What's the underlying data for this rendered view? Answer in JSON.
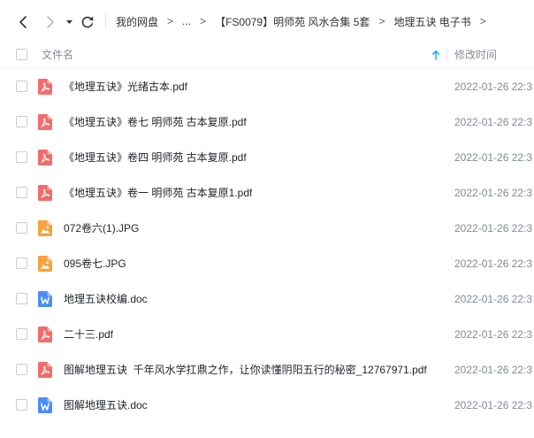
{
  "navigation": {
    "back_icon": "back-icon",
    "forward_icon": "forward-icon",
    "dropdown_icon": "history-dropdown-icon",
    "refresh_icon": "refresh-icon"
  },
  "breadcrumb": {
    "items": [
      "我的网盘",
      "...",
      "【FS0079】明师苑 风水合集 5套",
      "地理五诀 电子书"
    ],
    "separator": ">"
  },
  "table": {
    "columns": {
      "name": "文件名",
      "modified": "修改时间"
    },
    "sort": {
      "column": "name",
      "direction": "ascending",
      "icon": "sort-ascending-icon"
    },
    "rows": [
      {
        "name": "《地理五诀》光绪古本.pdf",
        "icon": "pdf-file-icon",
        "modified": "2022-01-26 22:3"
      },
      {
        "name": "《地理五诀》卷七 明师苑 古本复原.pdf",
        "icon": "pdf-file-icon",
        "modified": "2022-01-26 22:3"
      },
      {
        "name": "《地理五诀》卷四 明师苑 古本复原.pdf",
        "icon": "pdf-file-icon",
        "modified": "2022-01-26 22:3"
      },
      {
        "name": "《地理五诀》卷一 明师苑 古本复原1.pdf",
        "icon": "pdf-file-icon",
        "modified": "2022-01-26 22:3"
      },
      {
        "name": "072卷六(1).JPG",
        "icon": "image-file-icon",
        "modified": "2022-01-26 22:3"
      },
      {
        "name": "095卷七.JPG",
        "icon": "image-file-icon",
        "modified": "2022-01-26 22:3"
      },
      {
        "name": "地理五诀校编.doc",
        "icon": "word-file-icon",
        "modified": "2022-01-26 22:3"
      },
      {
        "name": "二十三.pdf",
        "icon": "pdf-file-icon",
        "modified": "2022-01-26 22:3"
      },
      {
        "name": "图解地理五诀  千年风水学扛鼎之作，让你读懂阴阳五行的秘密_12767971.pdf",
        "icon": "pdf-file-icon",
        "modified": "2022-01-26 22:3"
      },
      {
        "name": "图解地理五诀.doc",
        "icon": "word-file-icon",
        "modified": "2022-01-26 22:3"
      }
    ]
  },
  "colors": {
    "accent": "#06a7ff",
    "pdf": "#f26c6c",
    "image": "#f7a23e",
    "word": "#4b8df8"
  }
}
